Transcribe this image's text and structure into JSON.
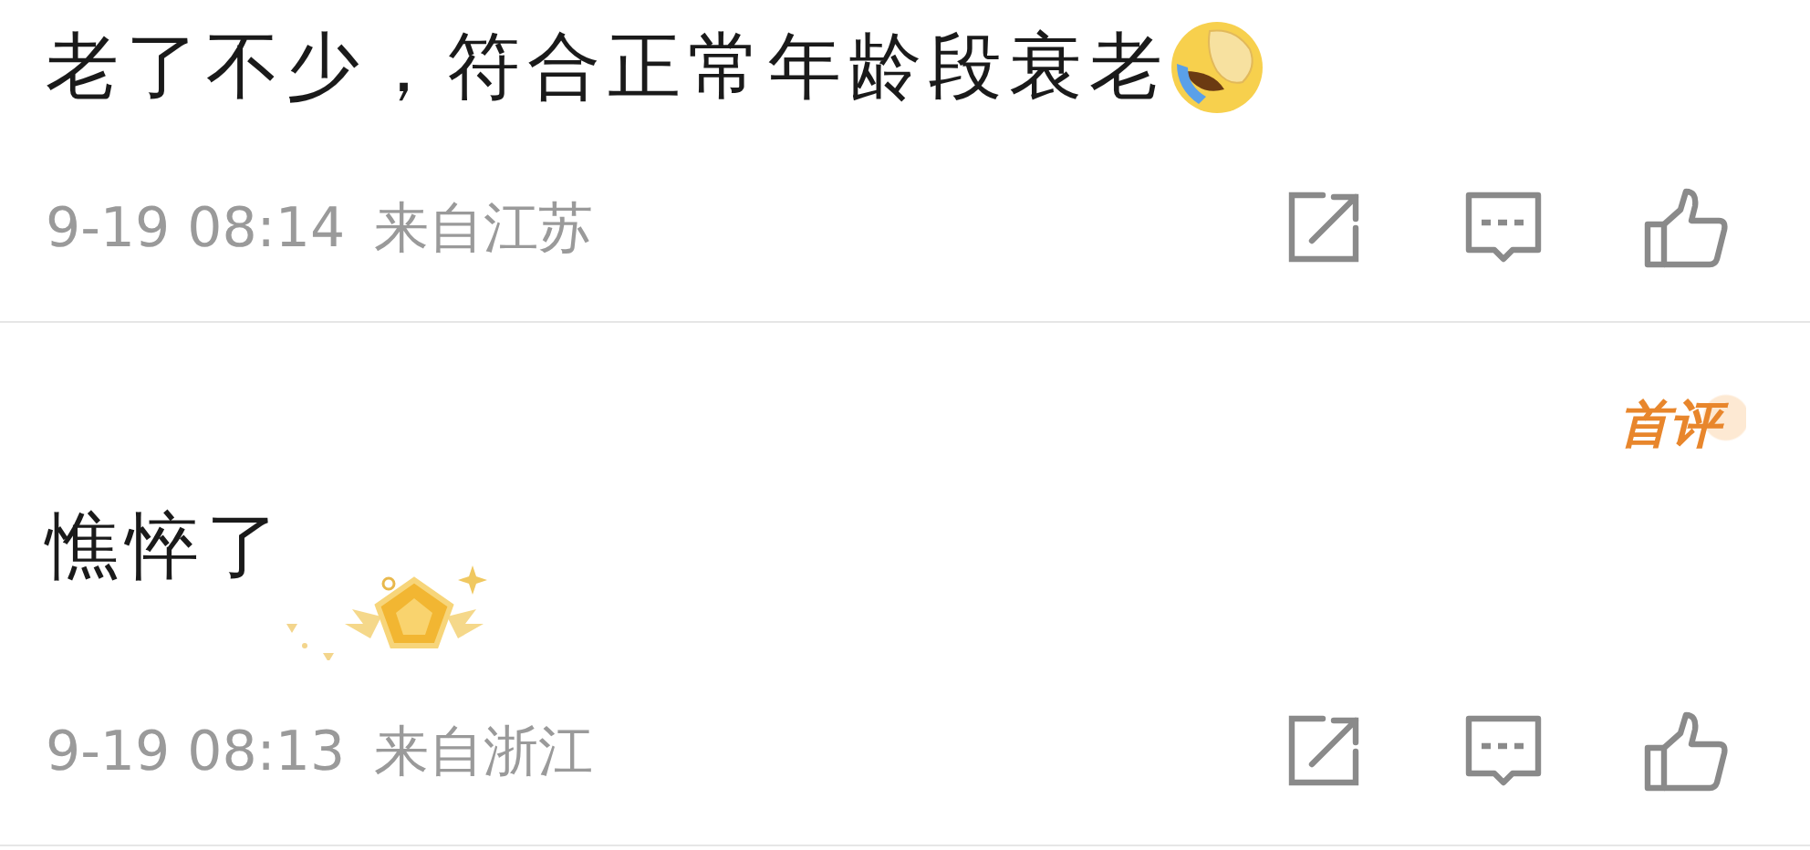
{
  "comments": [
    {
      "text": "老了不少，符合正常年龄段衰老",
      "emoji": true,
      "medal": false,
      "time": "9-19 08:14",
      "location": "来自江苏"
    },
    {
      "badge": "首评",
      "text": "憔悴了",
      "emoji": false,
      "medal": true,
      "time": "9-19 08:13",
      "location": "来自浙江"
    }
  ]
}
